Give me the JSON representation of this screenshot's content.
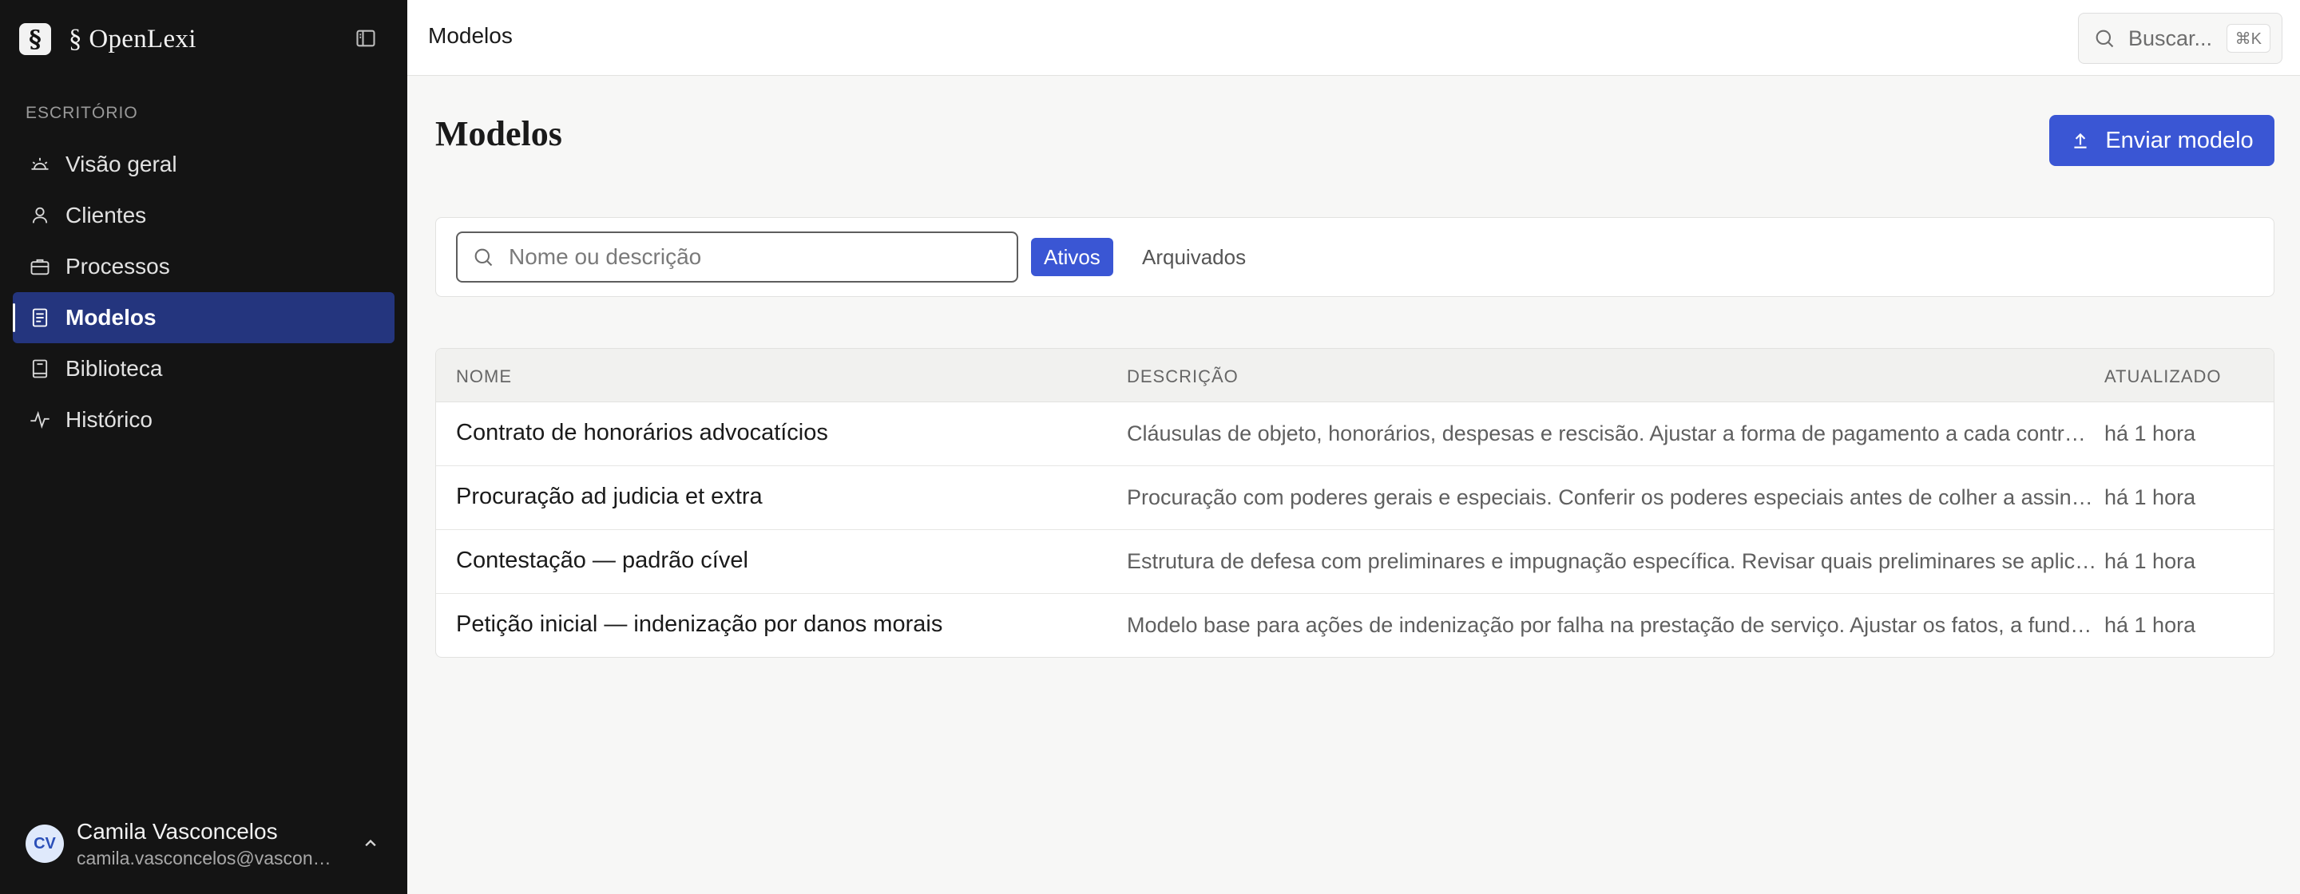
{
  "sidebar": {
    "brand_mark": "§",
    "brand_name": "§ OpenLexi",
    "section_label": "ESCRITÓRIO",
    "items": [
      {
        "label": "Visão geral",
        "icon": "sun-icon",
        "active": false
      },
      {
        "label": "Clientes",
        "icon": "user-icon",
        "active": false
      },
      {
        "label": "Processos",
        "icon": "briefcase-icon",
        "active": false
      },
      {
        "label": "Modelos",
        "icon": "document-icon",
        "active": true
      },
      {
        "label": "Biblioteca",
        "icon": "book-icon",
        "active": false
      },
      {
        "label": "Histórico",
        "icon": "activity-icon",
        "active": false
      }
    ],
    "user": {
      "initials": "CV",
      "name": "Camila Vasconcelos",
      "email": "camila.vasconcelos@vasconcelos.adv.br"
    }
  },
  "topbar": {
    "title": "Modelos",
    "search_label": "Buscar...",
    "search_shortcut": "⌘K"
  },
  "main": {
    "title": "Modelos",
    "upload_label": "Enviar modelo",
    "filter": {
      "placeholder": "Nome ou descrição",
      "tabs": [
        "Ativos",
        "Arquivados"
      ],
      "active_tab": "Ativos"
    },
    "table": {
      "columns": [
        "NOME",
        "DESCRIÇÃO",
        "ATUALIZADO"
      ],
      "rows": [
        {
          "name": "Contrato de honorários advocatícios",
          "description": "Cláusulas de objeto, honorários, despesas e rescisão. Ajustar a forma de pagamento a cada contrato.",
          "updated": "há 1 hora"
        },
        {
          "name": "Procuração ad judicia et extra",
          "description": "Procuração com poderes gerais e especiais. Conferir os poderes especiais antes de colher a assinatura.",
          "updated": "há 1 hora"
        },
        {
          "name": "Contestação — padrão cível",
          "description": "Estrutura de defesa com preliminares e impugnação específica. Revisar quais preliminares se aplicam.",
          "updated": "há 1 hora"
        },
        {
          "name": "Petição inicial — indenização por danos morais",
          "description": "Modelo base para ações de indenização por falha na prestação de serviço. Ajustar os fatos, a fundamentação e os pedidos.",
          "updated": "há 1 hora"
        }
      ]
    }
  },
  "colors": {
    "accent": "#3a56d4",
    "sidebar_bg": "#141414",
    "active_nav_bg": "#24357e"
  }
}
